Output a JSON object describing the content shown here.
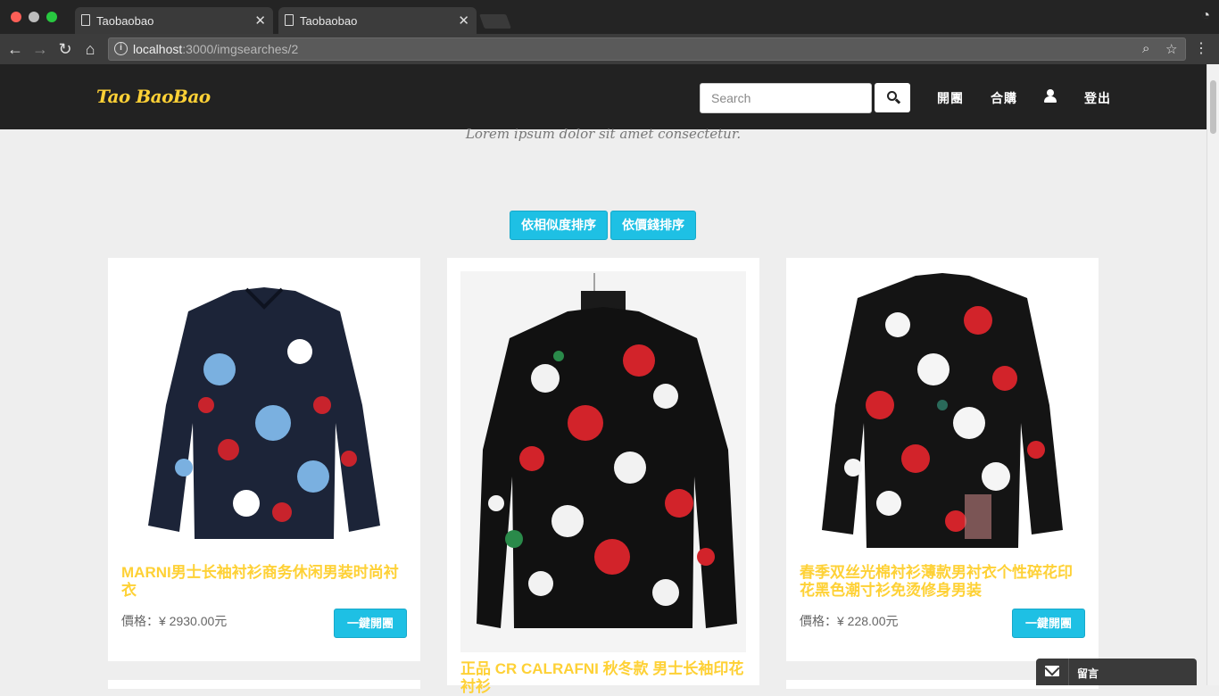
{
  "browser": {
    "tabs": [
      {
        "title": "Taobaobao",
        "close": "✕"
      },
      {
        "title": "Taobaobao",
        "close": "✕"
      }
    ],
    "url_host": "localhost",
    "url_path": ":3000/imgsearches/2"
  },
  "header": {
    "brand": "Tao BaoBao",
    "search_placeholder": "Search",
    "nav": [
      "開團",
      "合購",
      "登出"
    ]
  },
  "content": {
    "subheading": "Lorem ipsum dolor sit amet consectetur.",
    "sort_buttons": [
      "依相似度排序",
      "依價錢排序"
    ],
    "products": [
      {
        "title": "MARNI男士长袖衬衫商务休闲男装时尚衬衣",
        "price": "價格：¥ 2930.00元",
        "button": "一鍵開團",
        "shirt_color": "#1c2438",
        "accent": [
          "#7ab0e0",
          "#c8232c",
          "#ffffff"
        ]
      },
      {
        "title": "正品 CR CALRAFNI 秋冬款 男士长袖印花衬衫",
        "price": "",
        "button": "",
        "shirt_color": "#111111",
        "accent": [
          "#d2232a",
          "#f2f2f2",
          "#2a8a4a"
        ]
      },
      {
        "title": "春季双丝光棉衬衫薄款男衬衣个性碎花印花黑色潮寸衫免烫修身男装",
        "price": "價格：¥ 228.00元",
        "button": "一鍵開團",
        "shirt_color": "#141414",
        "accent": [
          "#d2232a",
          "#f5f5f5",
          "#2a6a5a"
        ]
      }
    ]
  },
  "chat": {
    "label": "留言"
  }
}
